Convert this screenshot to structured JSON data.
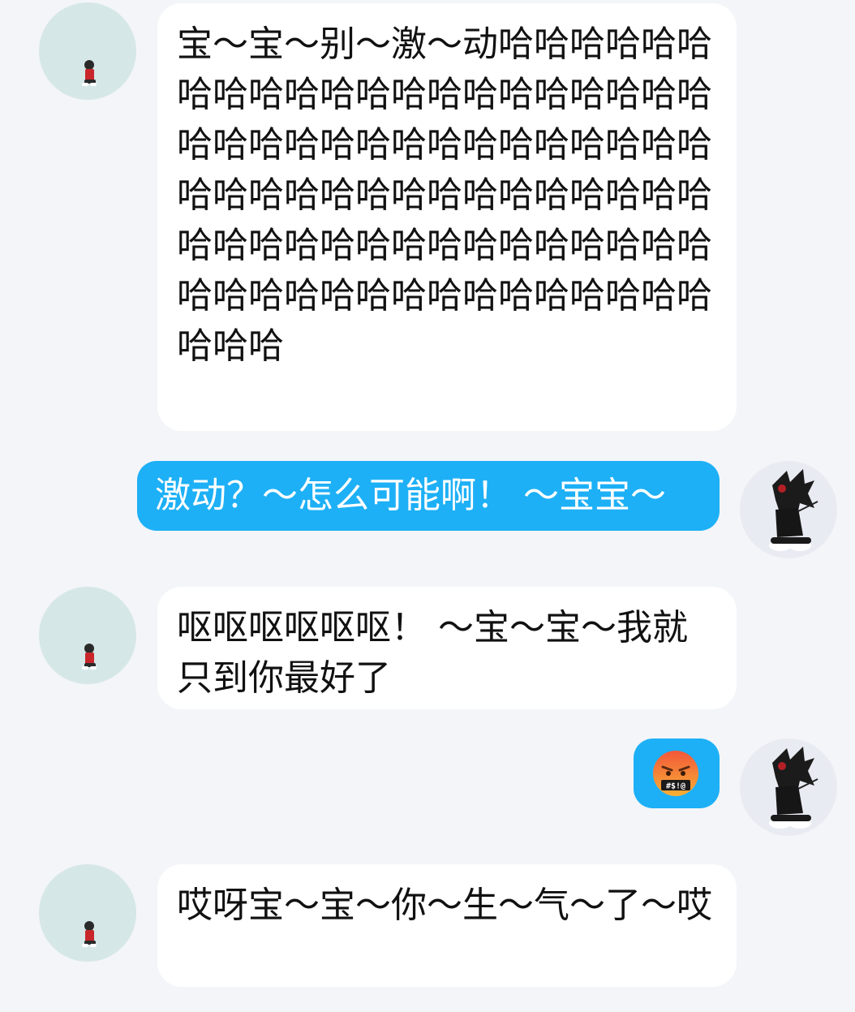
{
  "messages": [
    {
      "sender": "other",
      "text": "宝～宝～别～激～动哈哈哈哈哈哈哈哈哈哈哈哈哈哈哈哈哈哈哈哈哈哈哈哈哈哈哈哈哈哈哈哈哈哈哈哈哈哈哈哈哈哈哈哈哈哈哈哈哈哈哈哈哈哈哈哈哈哈哈哈哈哈哈哈哈哈哈哈哈哈哈哈哈哈哈哈哈哈哈哈哈哈哈哈"
    },
    {
      "sender": "me",
      "text": "激动？～怎么可能啊！ ～宝宝～"
    },
    {
      "sender": "other",
      "text": "呕呕呕呕呕呕！ ～宝～宝～我就只到你最好了"
    },
    {
      "sender": "me",
      "emoji": "face-with-symbols-on-mouth",
      "emoji_text": "#$!@"
    },
    {
      "sender": "other",
      "text": "哎呀宝～宝～你～生～气～了～哎"
    }
  ],
  "colors": {
    "background": "#f3f5f8",
    "self_bubble": "#1db0f6",
    "other_bubble": "#ffffff",
    "other_avatar_bg": "#d6e7e8",
    "self_avatar_bg": "#e9ebf2"
  }
}
